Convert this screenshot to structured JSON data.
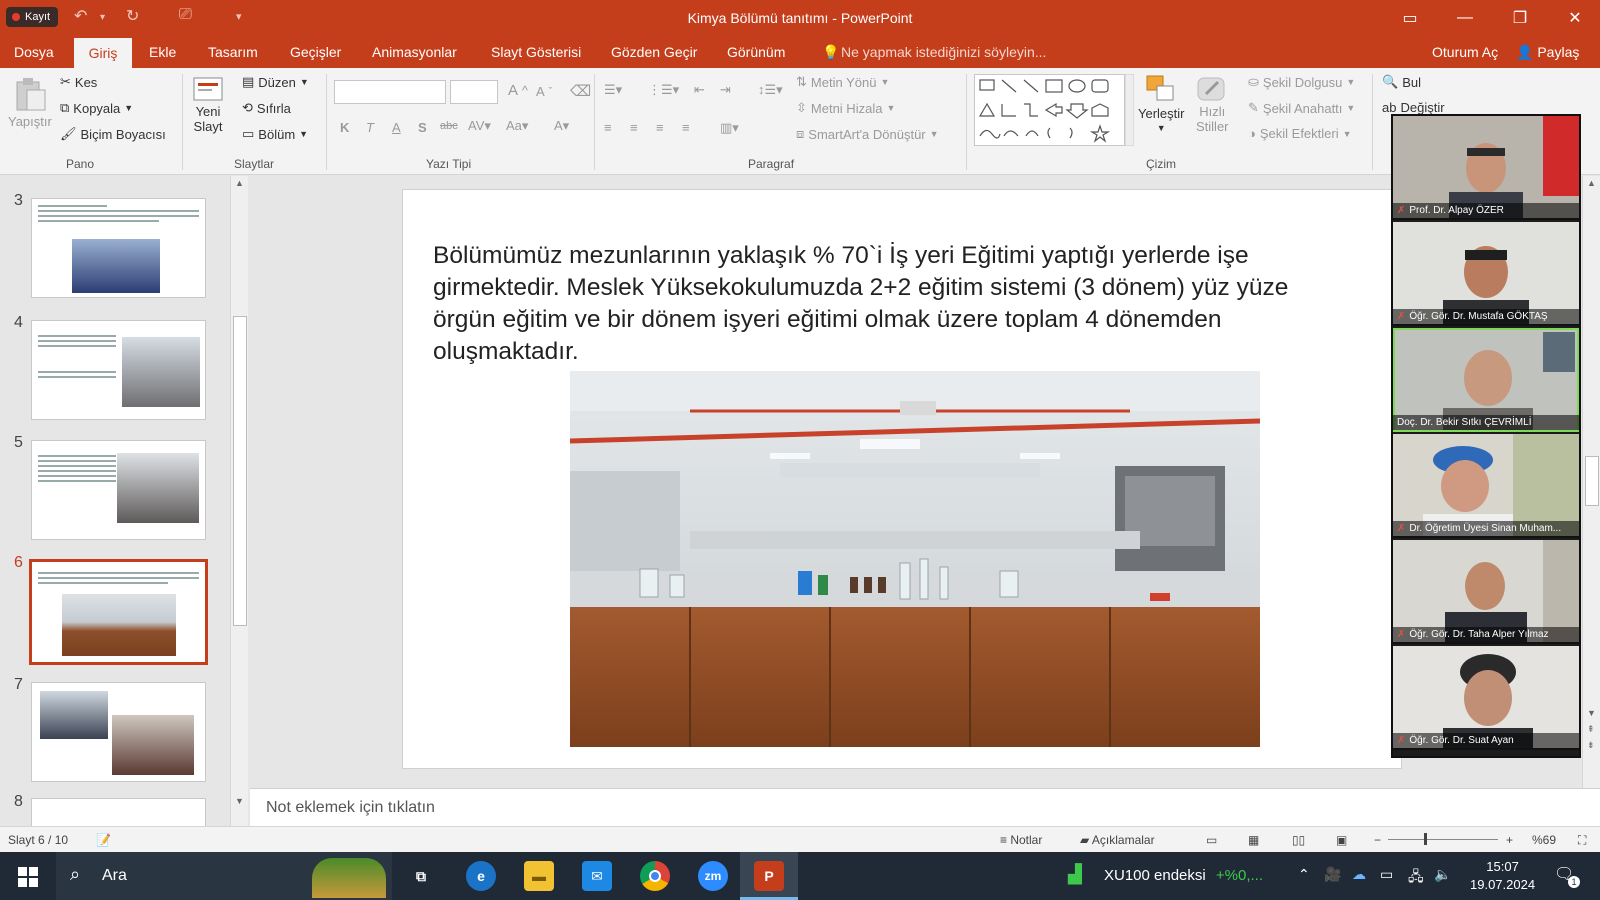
{
  "titlebar": {
    "recording_label": "Kayıt",
    "title": "Kimya Bölümü tanıtımı - PowerPoint",
    "colors": {
      "accent": "#c43e1c"
    }
  },
  "menu": {
    "file": "Dosya",
    "home": "Giriş",
    "insert": "Ekle",
    "design": "Tasarım",
    "transitions": "Geçişler",
    "animations": "Animasyonlar",
    "slideshow": "Slayt Gösterisi",
    "review": "Gözden Geçir",
    "view": "Görünüm",
    "tell_me": "Ne yapmak istediğinizi söyleyin...",
    "sign_in": "Oturum Aç",
    "share": "Paylaş"
  },
  "ribbon": {
    "clipboard": {
      "paste": "Yapıştır",
      "cut": "Kes",
      "copy": "Kopyala",
      "format_painter": "Biçim Boyacısı",
      "group": "Pano"
    },
    "slides": {
      "new_slide_1": "Yeni",
      "new_slide_2": "Slayt",
      "layout": "Düzen",
      "reset": "Sıfırla",
      "section": "Bölüm",
      "group": "Slaytlar"
    },
    "font": {
      "bold": "K",
      "italic": "T",
      "underline": "A",
      "shadow": "S",
      "strike": "abc",
      "group": "Yazı Tipi"
    },
    "paragraph": {
      "text_direction": "Metin Yönü",
      "align_text": "Metni Hizala",
      "smartart": "SmartArt'a Dönüştür",
      "group": "Paragraf"
    },
    "drawing": {
      "arrange": "Yerleştir",
      "quick_styles_1": "Hızlı",
      "quick_styles_2": "Stiller",
      "shape_fill": "Şekil Dolgusu",
      "shape_outline": "Şekil Anahattı",
      "shape_effects": "Şekil Efektleri",
      "group": "Çizim"
    },
    "editing": {
      "find": "Bul",
      "replace": "Değiştir"
    }
  },
  "thumbnails": [
    {
      "number": "3"
    },
    {
      "number": "4"
    },
    {
      "number": "5"
    },
    {
      "number": "6"
    },
    {
      "number": "7"
    },
    {
      "number": "8"
    }
  ],
  "slide": {
    "body_text": "Bölümümüz mezunlarının yaklaşık % 70`i İş yeri Eğitimi yaptığı yerlerde işe girmektedir. Meslek Yüksekokulumuzda  2+2 eğitim sistemi (3 dönem) yüz yüze örgün eğitim ve bir dönem işyeri eğitimi olmak üzere toplam 4 dönemden oluşmaktadır."
  },
  "notes": {
    "placeholder": "Not eklemek için tıklatın"
  },
  "status": {
    "slide_counter": "Slayt 6 / 10",
    "notes_label": "Notlar",
    "comments_label": "Açıklamalar",
    "zoom": "%69"
  },
  "participants": [
    {
      "name": "Prof. Dr. Alpay ÖZER"
    },
    {
      "name": "Öğr. Gör. Dr. Mustafa GÖKTAŞ"
    },
    {
      "name": "Doç. Dr. Bekir Sıtkı ÇEVRİMLİ"
    },
    {
      "name": "Dr. Öğretim Üyesi Sinan Muham..."
    },
    {
      "name": "Öğr. Gör. Dr. Taha Alper Yılmaz"
    },
    {
      "name": "Öğr. Gör. Dr. Suat Ayan"
    }
  ],
  "taskbar": {
    "search": "Ara",
    "stock_name": "XU100 endeksi",
    "stock_change": "+%0,...",
    "time": "15:07",
    "date": "19.07.2024",
    "notification_count": "1"
  }
}
